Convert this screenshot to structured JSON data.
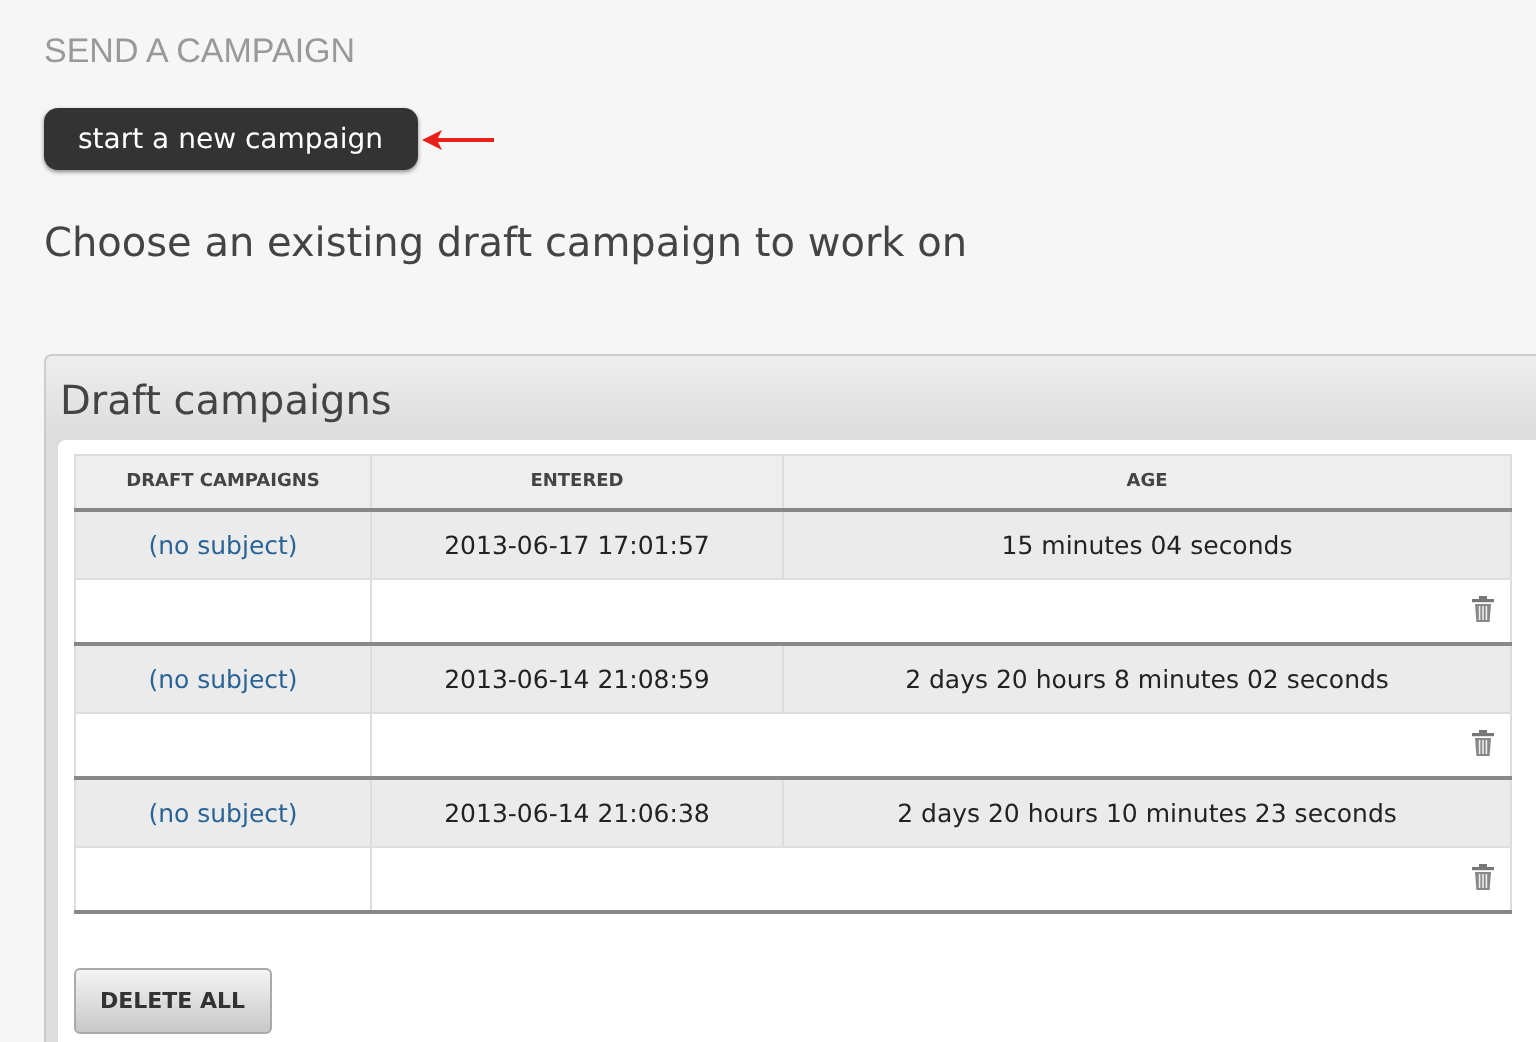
{
  "page_title": "SEND A CAMPAIGN",
  "new_button": "start a new campaign",
  "prompt": "Choose an existing draft campaign to work on",
  "panel": {
    "title": "Draft campaigns",
    "table": {
      "columns": [
        "DRAFT CAMPAIGNS",
        "ENTERED",
        "AGE"
      ],
      "rows": [
        {
          "subject": "(no subject)",
          "entered": "2013-06-17 17:01:57",
          "age": "15 minutes 04 seconds"
        },
        {
          "subject": "(no subject)",
          "entered": "2013-06-14 21:08:59",
          "age": "2 days 20 hours 8 minutes 02 seconds"
        },
        {
          "subject": "(no subject)",
          "entered": "2013-06-14 21:06:38",
          "age": "2 days 20 hours 10 minutes 23 seconds"
        }
      ]
    },
    "delete_all": "DELETE ALL"
  }
}
